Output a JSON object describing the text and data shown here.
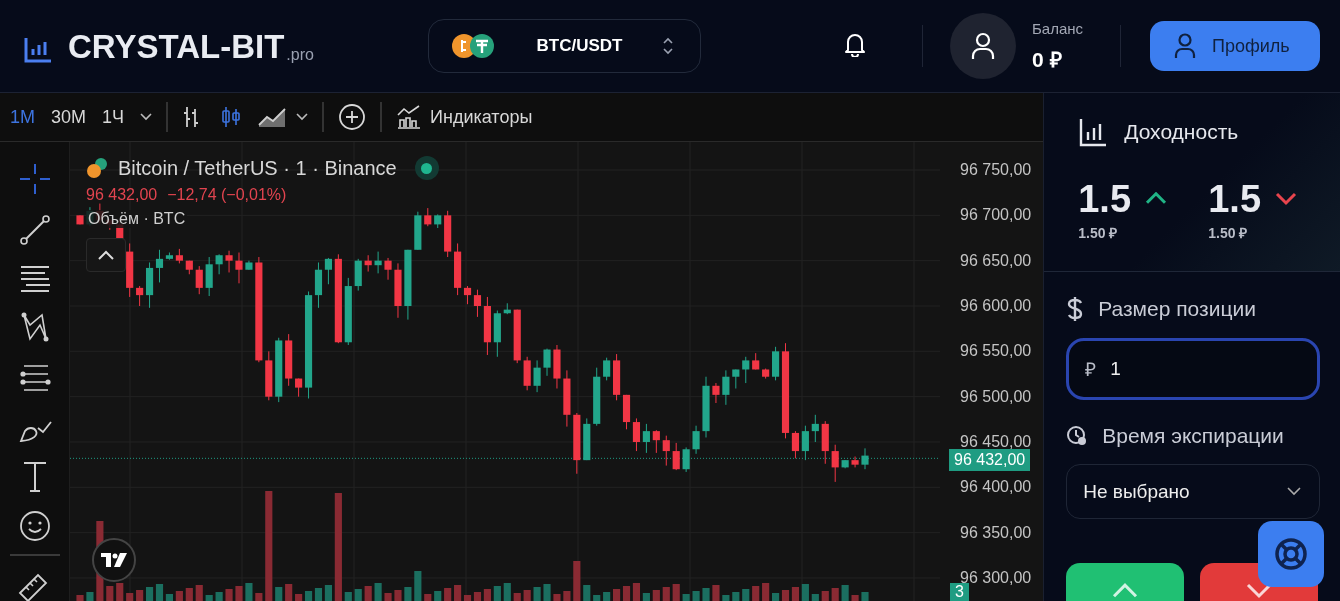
{
  "header": {
    "logo": {
      "name": "CRYSTAL-BIT",
      "suffix": ".pro"
    },
    "pair": "BTC/USDT",
    "balance": {
      "label": "Баланс",
      "value": "0 ₽"
    },
    "profile_button": "Профиль"
  },
  "toolbar": {
    "timeframes": [
      {
        "label": "1М",
        "selected": true
      },
      {
        "label": "30М",
        "selected": false
      },
      {
        "label": "1Ч",
        "selected": false
      }
    ],
    "chart_types": [
      {
        "kind": "bars",
        "selected": false
      },
      {
        "kind": "candles",
        "selected": true
      },
      {
        "kind": "area",
        "selected": false
      }
    ],
    "indicators": "Индикаторы"
  },
  "drawing_tools": [
    {
      "kind": "crosshair",
      "selected": true
    },
    {
      "kind": "trend-line",
      "selected": false
    },
    {
      "kind": "lines",
      "selected": false
    },
    {
      "kind": "pattern",
      "selected": false
    },
    {
      "kind": "projection",
      "selected": false
    },
    {
      "kind": "brush",
      "selected": false
    },
    {
      "kind": "text",
      "selected": false
    },
    {
      "kind": "emoji",
      "selected": false
    },
    {
      "kind": "ruler",
      "selected": false
    }
  ],
  "chart": {
    "title": "Bitcoin / TetherUS · 1 · Binance",
    "live": true,
    "price": "96 432,00",
    "change": "−12,74 (−0,01%)",
    "volume_label": "Объём · BTC",
    "price_axis": [
      "96 750,00",
      "96 700,00",
      "96 650,00",
      "96 600,00",
      "96 550,00",
      "96 500,00",
      "96 450,00",
      "96 400,00",
      "96 350,00",
      "96 300,00"
    ],
    "last_price": "96 432,00",
    "volume_tag": "3"
  },
  "panel": {
    "payout_title": "Доходность",
    "payouts": [
      {
        "kind": "up",
        "value": "1.5",
        "amount": "1.50 ₽"
      },
      {
        "kind": "down",
        "value": "1.5",
        "amount": "1.50 ₽"
      }
    ],
    "position": {
      "label": "Размер позиции",
      "currency": "₽",
      "value": "1",
      "focused": true
    },
    "expiry": {
      "label": "Время экспирации",
      "value": "Не выбрано"
    },
    "trade_buttons": [
      {
        "kind": "up"
      },
      {
        "kind": "down"
      }
    ]
  }
}
